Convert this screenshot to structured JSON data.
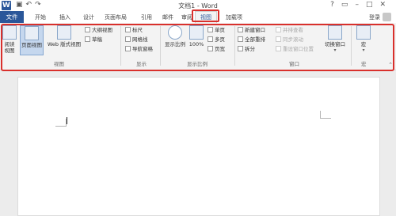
{
  "titlebar": {
    "app_icon": "W",
    "title": "文档1 - Word",
    "quick_access": [
      "save-icon",
      "undo-icon",
      "redo-icon"
    ],
    "window_controls": [
      "help",
      "ribbon-options",
      "minimize",
      "maximize",
      "close"
    ]
  },
  "tabs": {
    "file": "文件",
    "home": "开始",
    "insert": "插入",
    "design": "设计",
    "layout": "页面布局",
    "references": "引用",
    "mailings": "邮件",
    "review": "审阅",
    "view": "视图",
    "addins": "加载项",
    "login": "登录"
  },
  "ribbon": {
    "views": {
      "label": "视图",
      "read_mode": "阅读\n视图",
      "print_layout": "页面视图",
      "web_layout": "Web 版式视图",
      "outline": "大纲视图",
      "draft": "草稿"
    },
    "show": {
      "label": "显示",
      "ruler": "标尺",
      "gridlines": "网格线",
      "nav_pane": "导航窗格"
    },
    "zoom": {
      "label": "显示比例",
      "zoom": "显示比例",
      "hundred": "100%",
      "one_page": "单页",
      "multi_page": "多页",
      "page_width": "页宽"
    },
    "window": {
      "label": "窗口",
      "new_window": "新建窗口",
      "arrange_all": "全部重排",
      "split": "拆分",
      "side_by_side": "并排查看",
      "sync_scroll": "同步滚动",
      "reset_position": "重设窗口位置",
      "switch_windows": "切换窗口"
    },
    "macros": {
      "label": "宏",
      "macros": "宏"
    }
  },
  "colors": {
    "accent": "#2b579a",
    "highlight": "#d9302c"
  }
}
